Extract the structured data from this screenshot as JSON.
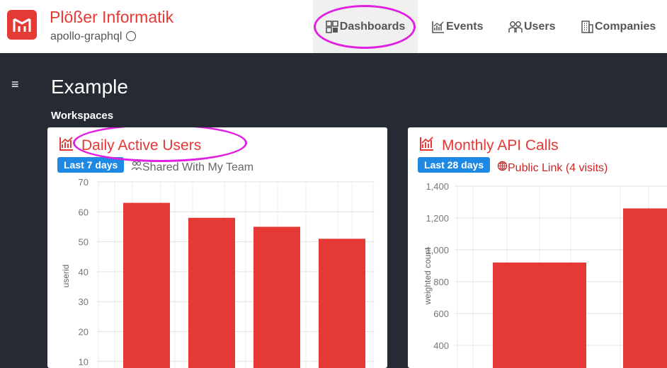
{
  "header": {
    "brand_title": "Plößer Informatik",
    "brand_subtitle": "apollo-graphql",
    "brand_color": "#e53935",
    "nav": [
      {
        "label": "Dashboards",
        "icon": "dashboard-icon",
        "active": true
      },
      {
        "label": "Events",
        "icon": "chart-icon"
      },
      {
        "label": "Users",
        "icon": "users-icon"
      },
      {
        "label": "Companies",
        "icon": "building-icon"
      }
    ]
  },
  "page": {
    "menu_icon": "≡",
    "title": "Example",
    "section_label": "Workspaces"
  },
  "cards": [
    {
      "title": "Daily Active Users",
      "badge": "Last 7 days",
      "share_text": "Shared With My Team",
      "share_icon": "team-icon"
    },
    {
      "title": "Monthly API Calls",
      "badge": "Last 28 days",
      "share_text": "Public Link (4 visits)",
      "share_icon": "globe-icon"
    }
  ],
  "chart_data": [
    {
      "type": "bar",
      "title": "Daily Active Users",
      "ylabel": "userid",
      "ylim": [
        10,
        70
      ],
      "yticks": [
        "70",
        "60",
        "50",
        "40",
        "30",
        "20",
        "10"
      ],
      "values": [
        63,
        58,
        55,
        51
      ],
      "bar_color": "#e53935"
    },
    {
      "type": "bar",
      "title": "Monthly API Calls",
      "ylabel": "weighted count",
      "ylim": [
        400,
        1400
      ],
      "yticks": [
        "1,400",
        "1,200",
        "1,000",
        "800",
        "600",
        "400"
      ],
      "values": [
        920,
        1260
      ],
      "bar_color": "#e53935"
    }
  ]
}
